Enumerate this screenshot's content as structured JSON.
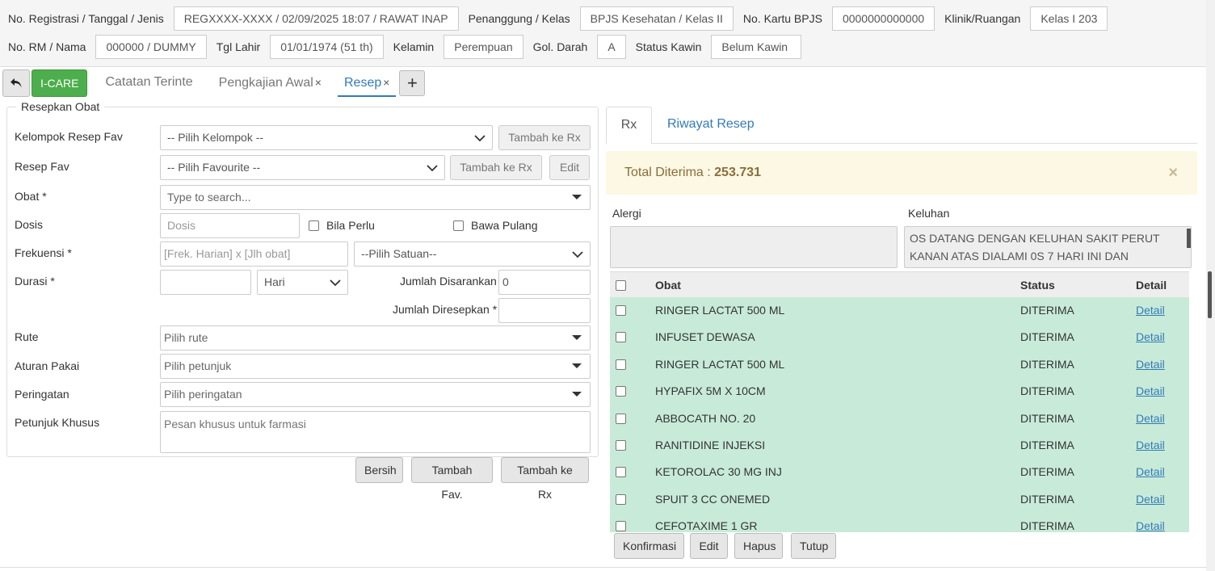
{
  "header": {
    "row1": [
      {
        "label": "No. Registrasi / Tanggal / Jenis",
        "value": "REGXXXX-XXXX / 02/09/2025 18:07 / RAWAT INAP"
      },
      {
        "label": "Penanggung / Kelas",
        "value": "BPJS Kesehatan / Kelas II"
      },
      {
        "label": "No. Kartu BPJS",
        "value": "0000000000000"
      },
      {
        "label": "Klinik/Ruangan",
        "value": "Kelas I 203"
      }
    ],
    "row2": [
      {
        "label": "No. RM / Nama",
        "value": "000000 / DUMMY"
      },
      {
        "label": "Tgl Lahir",
        "value": "01/01/1974 (51 th)"
      },
      {
        "label": "Kelamin",
        "value": "Perempuan"
      },
      {
        "label": "Gol. Darah",
        "value": "A"
      },
      {
        "label": "Status Kawin",
        "value": "Belum Kawin"
      }
    ]
  },
  "tabs": {
    "icare": "I-CARE",
    "items": [
      {
        "label": "Catatan Terinte",
        "closable": false
      },
      {
        "label": "Pengkajian Awal",
        "closable": true
      },
      {
        "label": "Resep",
        "closable": true
      }
    ],
    "close_glyph": "×",
    "add_glyph": "+"
  },
  "form": {
    "legend": "Resepkan Obat",
    "kelompok": {
      "label": "Kelompok Resep Fav",
      "value": "-- Pilih Kelompok --",
      "button": "Tambah ke Rx"
    },
    "resep_fav": {
      "label": "Resep Fav",
      "value": "-- Pilih Favourite --",
      "button": "Tambah ke Rx",
      "edit": "Edit"
    },
    "obat": {
      "label": "Obat *",
      "placeholder": "Type to search..."
    },
    "dosis": {
      "label": "Dosis",
      "placeholder": "Dosis",
      "bila_perlu": "Bila Perlu",
      "bawa_pulang": "Bawa Pulang"
    },
    "frekuensi": {
      "label": "Frekuensi *",
      "placeholder": "[Frek. Harian] x [Jlh obat]",
      "satuan": "--Pilih Satuan--"
    },
    "durasi": {
      "label": "Durasi *",
      "unit": "Hari",
      "jumlah_disarankan_label": "Jumlah Disarankan",
      "jumlah_disarankan": "0"
    },
    "jumlah_diresepkan_label": "Jumlah Diresepkan *",
    "rute": {
      "label": "Rute",
      "placeholder": "Pilih rute"
    },
    "aturan": {
      "label": "Aturan Pakai",
      "placeholder": "Pilih petunjuk"
    },
    "peringatan": {
      "label": "Peringatan",
      "placeholder": "Pilih peringatan"
    },
    "petunjuk": {
      "label": "Petunjuk Khusus",
      "placeholder": "Pesan khusus untuk farmasi"
    },
    "buttons": {
      "bersih": "Bersih",
      "tambah_fav": "Tambah Fav.",
      "tambah_rx": "Tambah ke Rx"
    }
  },
  "right": {
    "tabs": {
      "rx": "Rx",
      "riwayat": "Riwayat Resep"
    },
    "alert": {
      "label": "Total Diterima : ",
      "value": "253.731",
      "close": "×"
    },
    "alergi": {
      "label": "Alergi",
      "value": ""
    },
    "keluhan": {
      "label": "Keluhan",
      "value": "OS DATANG DENGAN KELUHAN SAKIT PERUT KANAN ATAS DIALAMI 0S 7 HARI INI DAN"
    },
    "table": {
      "headers": {
        "obat": "Obat",
        "status": "Status",
        "detail": "Detail"
      },
      "rows": [
        {
          "obat": "RINGER LACTAT 500 ML",
          "status": "DITERIMA",
          "detail": "Detail"
        },
        {
          "obat": "INFUSET DEWASA",
          "status": "DITERIMA",
          "detail": "Detail"
        },
        {
          "obat": "RINGER LACTAT 500 ML",
          "status": "DITERIMA",
          "detail": "Detail"
        },
        {
          "obat": "HYPAFIX 5M X 10CM",
          "status": "DITERIMA",
          "detail": "Detail"
        },
        {
          "obat": "ABBOCATH NO. 20",
          "status": "DITERIMA",
          "detail": "Detail"
        },
        {
          "obat": "RANITIDINE INJEKSI",
          "status": "DITERIMA",
          "detail": "Detail"
        },
        {
          "obat": "KETOROLAC 30 MG INJ",
          "status": "DITERIMA",
          "detail": "Detail"
        },
        {
          "obat": "SPUIT 3 CC ONEMED",
          "status": "DITERIMA",
          "detail": "Detail"
        },
        {
          "obat": "CEFOTAXIME 1 GR",
          "status": "DITERIMA",
          "detail": "Detail"
        }
      ]
    },
    "actions": {
      "konfirmasi": "Konfirmasi",
      "edit": "Edit",
      "hapus": "Hapus",
      "tutup": "Tutup"
    }
  },
  "colors": {
    "accent": "#337ab7",
    "icare": "#4cae4c",
    "row_bg": "#c8ebd9",
    "alert_bg": "#fcf8e3",
    "alert_text": "#8a6d3b"
  },
  "icons": {
    "back": "undo-arrow-icon",
    "add": "plus-icon",
    "close": "close-icon",
    "dropdown": "caret-down-icon",
    "chevron": "chevron-down-icon"
  }
}
